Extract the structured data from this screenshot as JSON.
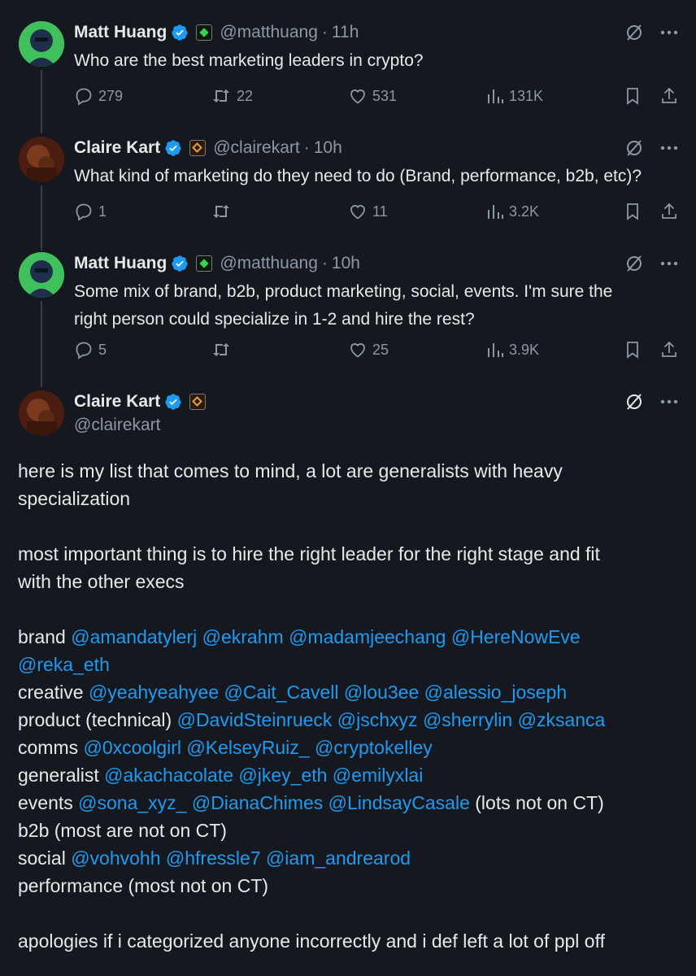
{
  "tweets": [
    {
      "name": "Matt Huang",
      "handle": "@matthuang",
      "time": "11h",
      "text": "Who are the best marketing leaders in crypto?",
      "replies": "279",
      "retweets": "22",
      "likes": "531",
      "views": "131K"
    },
    {
      "name": "Claire Kart",
      "handle": "@clairekart",
      "time": "10h",
      "text": "What kind of marketing do they need to do (Brand, performance, b2b, etc)?",
      "replies": "1",
      "retweets": "",
      "likes": "11",
      "views": "3.2K"
    },
    {
      "name": "Matt Huang",
      "handle": "@matthuang",
      "time": "10h",
      "text_line1": "Some mix of brand, b2b, product marketing, social, events. I'm sure the",
      "text_line2": "right person could specialize in 1-2 and hire the rest?",
      "replies": "5",
      "retweets": "",
      "likes": "25",
      "views": "3.9K"
    }
  ],
  "main": {
    "name": "Claire Kart",
    "handle": "@clairekart",
    "intro_line1": "here is my list that comes to mind, a lot are generalists with heavy",
    "intro_line2": "specialization",
    "important_line1": "most important thing is to hire the right leader for the right stage and fit",
    "important_line2": "with the other execs",
    "brand_label": "brand ",
    "brand_mentions": "@amandatylerj @ekrahm @madamjeechang @HereNowEve",
    "brand_mentions2": "@reka_eth",
    "creative_label": "creative ",
    "creative_mentions": "@yeahyeahyee @Cait_Cavell @lou3ee @alessio_joseph",
    "product_label": "product (technical) ",
    "product_mentions": "@DavidSteinrueck @jschxyz @sherrylin @zksanca",
    "comms_label": "comms ",
    "comms_mentions": "@0xcoolgirl @KelseyRuiz_ @cryptokelley",
    "generalist_label": "generalist ",
    "generalist_mentions": "@akachacolate @jkey_eth @emilyxlai",
    "events_label": "events ",
    "events_mentions": "@sona_xyz_ @DianaChimes @LindsayCasale",
    "events_suffix": " (lots not on CT)",
    "b2b_line": "b2b (most are not on CT)",
    "social_label": "social ",
    "social_mentions": "@vohvohh @hfressle7 @iam_andrearod",
    "performance_line": "performance (most not on CT)",
    "apologies_line": "apologies if i categorized anyone incorrectly and i def left a lot of ppl off"
  },
  "colors": {
    "background": "#15181f",
    "mention": "#1d9bf0",
    "muted": "#8b98a5"
  }
}
